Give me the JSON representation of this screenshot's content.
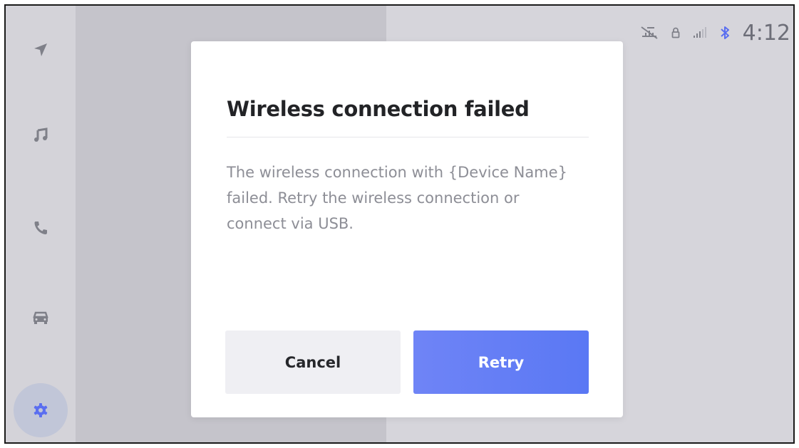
{
  "status_bar": {
    "time": "4:12",
    "icons": [
      "no-gps-icon",
      "lock-icon",
      "signal-bars-icon",
      "bluetooth-icon"
    ]
  },
  "sidebar": {
    "items": [
      {
        "name": "navigation",
        "icon": "navigation-arrow-icon",
        "active": false
      },
      {
        "name": "media",
        "icon": "music-note-icon",
        "active": false
      },
      {
        "name": "phone",
        "icon": "phone-icon",
        "active": false
      },
      {
        "name": "vehicle",
        "icon": "car-icon",
        "active": false
      },
      {
        "name": "settings",
        "icon": "gear-icon",
        "active": true
      }
    ]
  },
  "dialog": {
    "title": "Wireless connection failed",
    "body": "The wireless connection with {Device Name} failed. Retry the wireless connection or connect via USB.",
    "cancel_label": "Cancel",
    "retry_label": "Retry"
  },
  "colors": {
    "accent": "#6278f5",
    "icon_gray": "#7f8089",
    "active_icon": "#5a6ef0"
  }
}
